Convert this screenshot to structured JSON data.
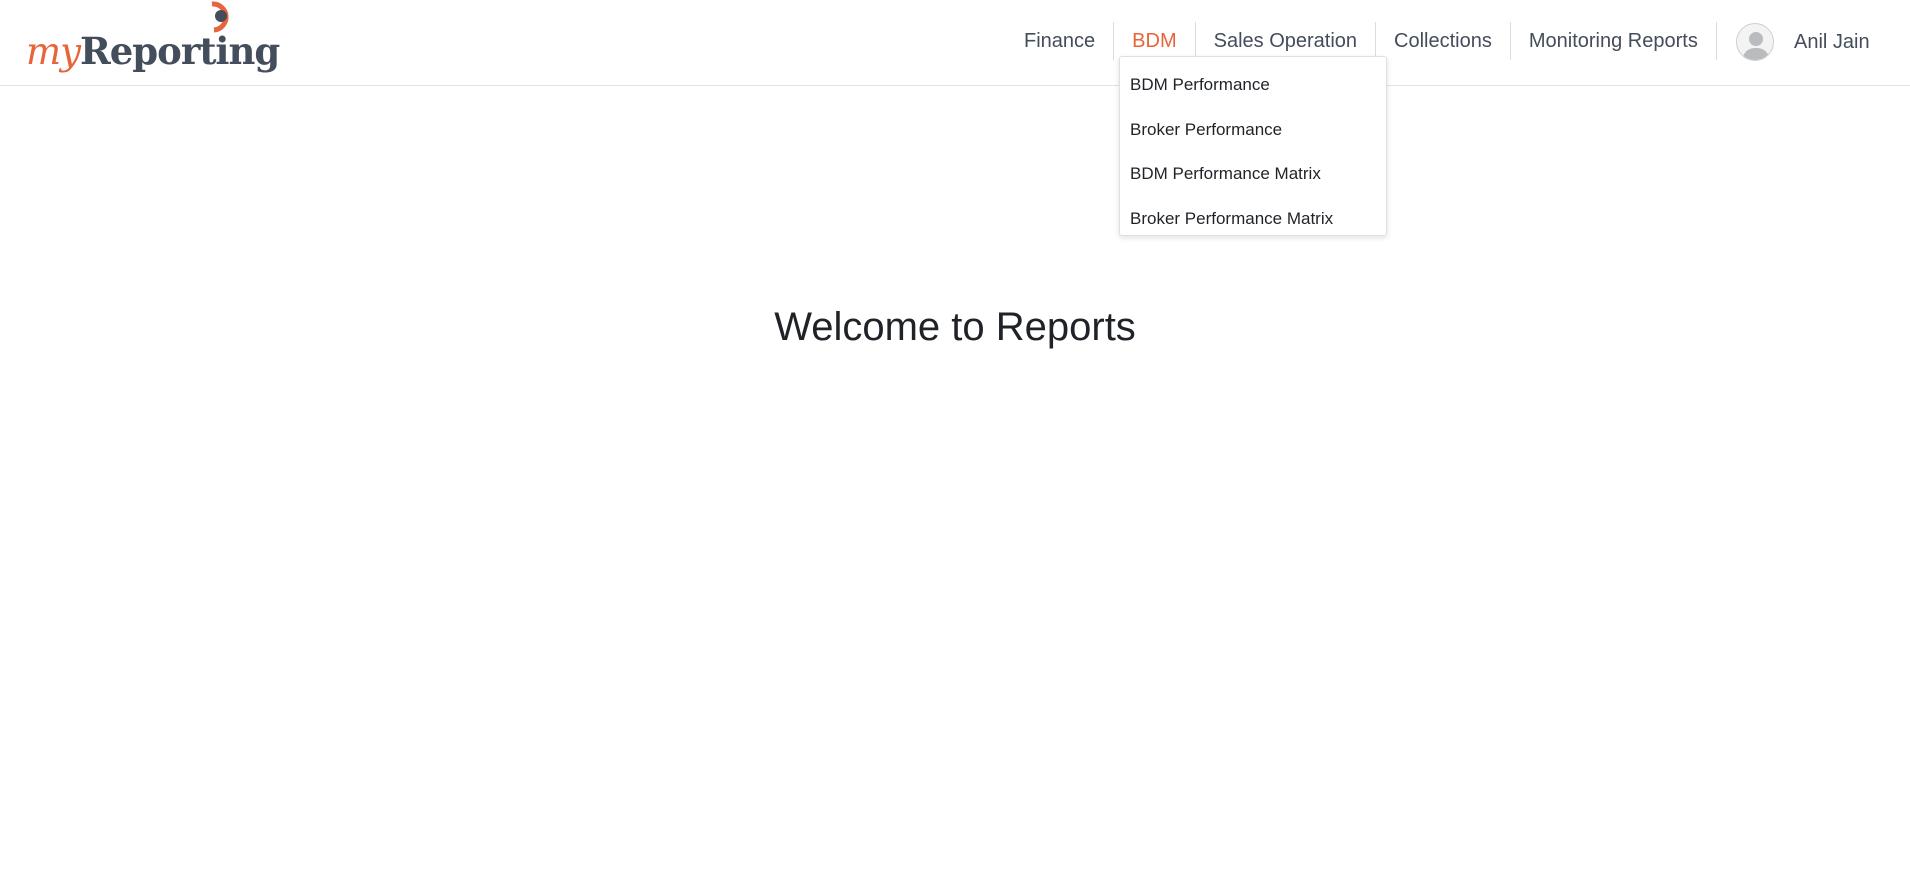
{
  "brand": {
    "logo_my": "my",
    "logo_reporting": "Reporting",
    "accent_color": "#e8643a",
    "text_color": "#434d5b"
  },
  "nav": {
    "items": [
      {
        "label": "Finance",
        "active": false
      },
      {
        "label": "BDM",
        "active": true
      },
      {
        "label": "Sales Operation",
        "active": false
      },
      {
        "label": "Collections",
        "active": false
      },
      {
        "label": "Monitoring Reports",
        "active": false
      }
    ]
  },
  "user": {
    "name": "Anil Jain",
    "avatar_icon": "user-avatar-icon"
  },
  "dropdown": {
    "parent": "BDM",
    "items": [
      {
        "label": "BDM Performance"
      },
      {
        "label": "Broker Performance"
      },
      {
        "label": "BDM Performance Matrix"
      },
      {
        "label": "Broker Performance Matrix"
      }
    ]
  },
  "main": {
    "welcome": "Welcome to Reports"
  }
}
